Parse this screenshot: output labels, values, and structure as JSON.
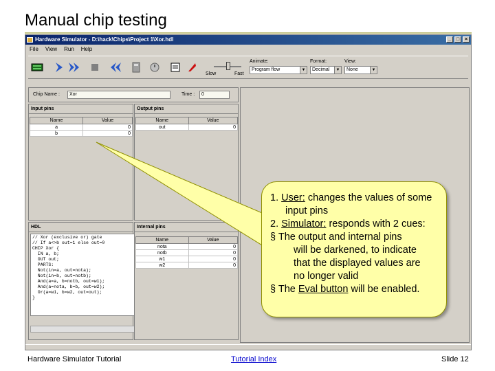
{
  "slide": {
    "title": "Manual chip testing",
    "footer_left": "Hardware Simulator Tutorial",
    "footer_link": "Tutorial Index",
    "footer_right": "Slide 12"
  },
  "window": {
    "title": "Hardware Simulator - D:\\hack\\Chips\\Project 1\\Xor.hdl",
    "menu": [
      "File",
      "View",
      "Run",
      "Help"
    ],
    "slow_label": "Slow",
    "fast_label": "Fast",
    "animate_label": "Animate:",
    "animate_value": "Program flow",
    "format_label": "Format:",
    "format_value": "Decimal",
    "view_label": "View:",
    "view_value": "None",
    "chip_name_label": "Chip Name :",
    "chip_name_value": "Xor",
    "time_label": "Time :",
    "time_value": "0"
  },
  "input_pins": {
    "title": "Input pins",
    "headers": [
      "Name",
      "Value"
    ],
    "rows": [
      {
        "name": "a",
        "value": "0"
      },
      {
        "name": "b",
        "value": "0"
      }
    ]
  },
  "output_pins": {
    "title": "Output pins",
    "headers": [
      "Name",
      "Value"
    ],
    "rows": [
      {
        "name": "out",
        "value": "0"
      }
    ]
  },
  "hdl": {
    "title": "HDL",
    "lines": [
      "// Xor (exclusive or) gate",
      "// If a<>b out=1 else out=0",
      "CHIP Xor {",
      "  IN a, b;",
      "  OUT out;",
      "  PARTS:",
      "  Not(in=a, out=nota);",
      "  Not(in=b, out=notb);",
      "  And(a=a, b=notb, out=w1);",
      "  And(a=nota, b=b, out=w2);",
      "  Or(a=w1, b=w2, out=out);",
      "}"
    ]
  },
  "internal_pins": {
    "title": "Internal pins",
    "headers": [
      "Name",
      "Value"
    ],
    "rows": [
      {
        "name": "nota",
        "value": "0"
      },
      {
        "name": "notb",
        "value": "0"
      },
      {
        "name": "w1",
        "value": "0"
      },
      {
        "name": "w2",
        "value": "0"
      }
    ]
  },
  "callout": {
    "n1": "1.",
    "user": "User:",
    "line1_rest": "changes the values of some",
    "line1b": "input pins",
    "n2": "2.",
    "simulator": "Simulator:",
    "line2_rest": "responds with 2 cues:",
    "bullet": "§",
    "b1_l1": "The output and internal pins",
    "b1_l2": "will be darkened, to indicate",
    "b1_l3": "that the displayed values are",
    "b1_l4": "no longer valid",
    "b2_pre": "The",
    "eval": "Eval button",
    "b2_post": "will be enabled."
  },
  "colors": {
    "callout_fill": "#ffffa8",
    "titlebar": "#0a246a",
    "window_bg": "#d4d0c8",
    "link": "#0000cc"
  }
}
